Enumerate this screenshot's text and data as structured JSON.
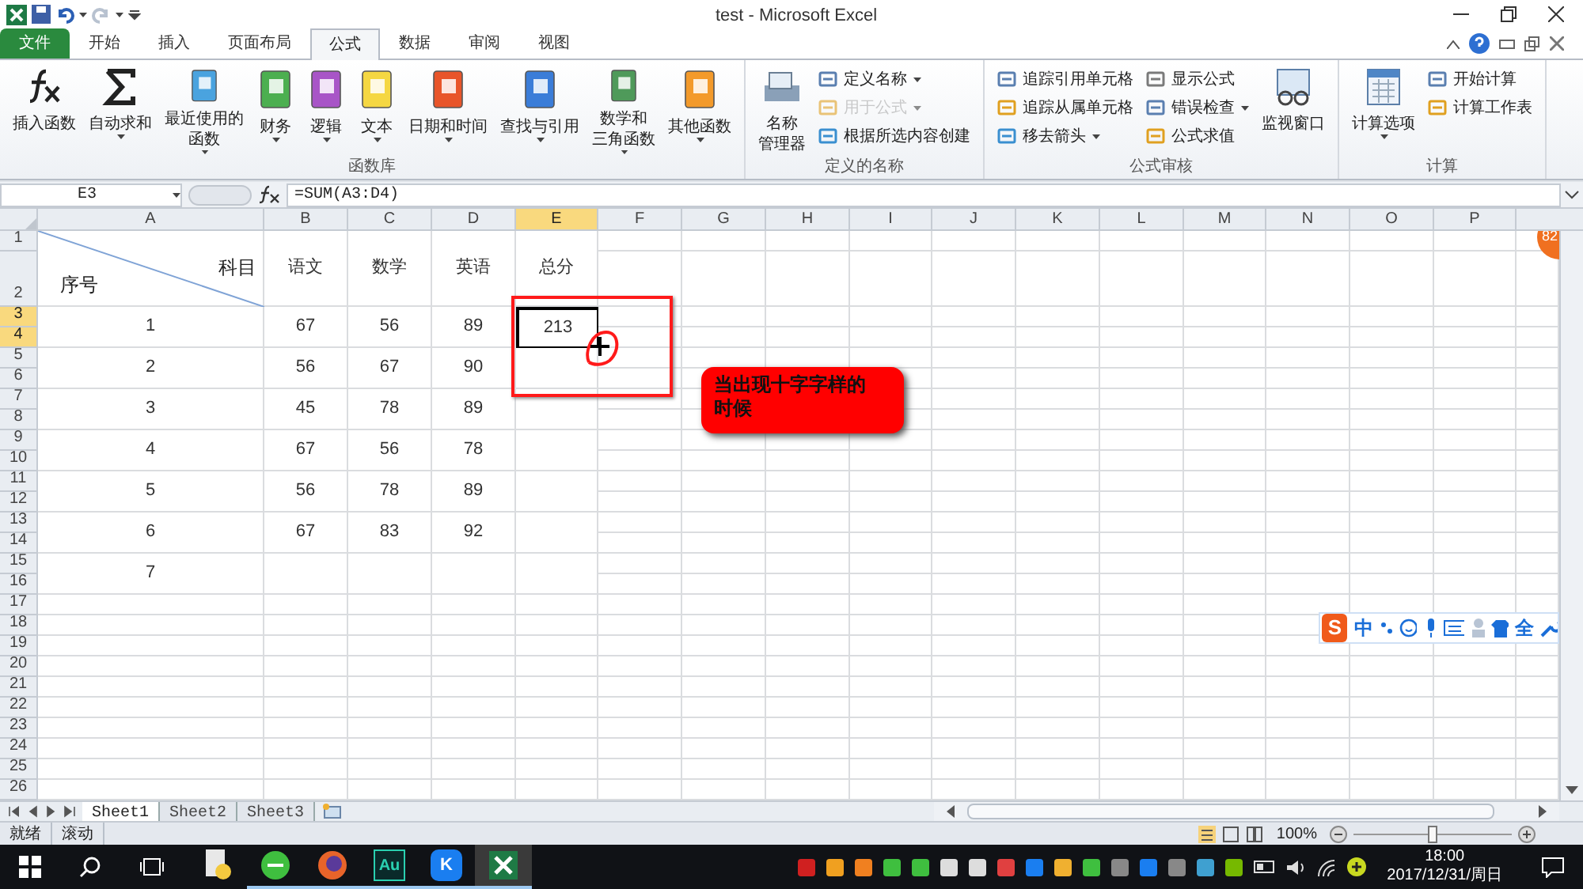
{
  "window": {
    "title": "test - Microsoft Excel"
  },
  "ribbon_tabs": [
    {
      "label": "文件",
      "kind": "file",
      "selected": false
    },
    {
      "label": "开始",
      "kind": "tab",
      "selected": false
    },
    {
      "label": "插入",
      "kind": "tab",
      "selected": false
    },
    {
      "label": "页面布局",
      "kind": "tab",
      "selected": false
    },
    {
      "label": "公式",
      "kind": "tab",
      "selected": true
    },
    {
      "label": "数据",
      "kind": "tab",
      "selected": false
    },
    {
      "label": "审阅",
      "kind": "tab",
      "selected": false
    },
    {
      "label": "视图",
      "kind": "tab",
      "selected": false
    }
  ],
  "ribbon_groups": [
    {
      "label": "函数库",
      "large": [
        {
          "lines": [
            "插入函数"
          ],
          "dropdown": false
        },
        {
          "lines": [
            "自动求和"
          ],
          "dropdown": true
        },
        {
          "lines": [
            "最近使用的",
            "函数"
          ],
          "dropdown": true
        },
        {
          "lines": [
            "财务"
          ],
          "dropdown": true
        },
        {
          "lines": [
            "逻辑"
          ],
          "dropdown": true
        },
        {
          "lines": [
            "文本"
          ],
          "dropdown": true
        },
        {
          "lines": [
            "日期和时间"
          ],
          "dropdown": true
        },
        {
          "lines": [
            "查找与引用"
          ],
          "dropdown": true
        },
        {
          "lines": [
            "数学和",
            "三角函数"
          ],
          "dropdown": true
        },
        {
          "lines": [
            "其他函数"
          ],
          "dropdown": true
        }
      ]
    },
    {
      "label": "定义的名称",
      "large": [
        {
          "lines": [
            "名称",
            "管理器"
          ],
          "dropdown": false
        }
      ],
      "small": [
        [
          {
            "label": "定义名称",
            "dropdown": true,
            "disabled": false
          },
          {
            "label": "用于公式",
            "dropdown": true,
            "disabled": true
          },
          {
            "label": "根据所选内容创建",
            "dropdown": false,
            "disabled": false
          }
        ]
      ]
    },
    {
      "label": "公式审核",
      "small": [
        [
          {
            "label": "追踪引用单元格",
            "dropdown": false,
            "disabled": false
          },
          {
            "label": "追踪从属单元格",
            "dropdown": false,
            "disabled": false
          },
          {
            "label": "移去箭头",
            "dropdown": true,
            "disabled": false
          }
        ],
        [
          {
            "label": "显示公式",
            "dropdown": false,
            "disabled": false
          },
          {
            "label": "错误检查",
            "dropdown": true,
            "disabled": false
          },
          {
            "label": "公式求值",
            "dropdown": false,
            "disabled": false
          }
        ]
      ],
      "trailing": [
        {
          "lines": [
            "监视窗口"
          ],
          "dropdown": false
        }
      ]
    },
    {
      "label": "计算",
      "large": [
        {
          "lines": [
            "计算选项"
          ],
          "dropdown": true
        }
      ],
      "small": [
        [
          {
            "label": "开始计算",
            "dropdown": false,
            "disabled": false
          },
          {
            "label": "计算工作表",
            "dropdown": false,
            "disabled": false
          }
        ]
      ]
    }
  ],
  "formula_bar": {
    "name_box": "E3",
    "formula": "=SUM(A3:D4)"
  },
  "columns": [
    {
      "label": "A",
      "selected": false
    },
    {
      "label": "B",
      "selected": false
    },
    {
      "label": "C",
      "selected": false
    },
    {
      "label": "D",
      "selected": false
    },
    {
      "label": "E",
      "selected": true
    },
    {
      "label": "F",
      "selected": false
    },
    {
      "label": "G",
      "selected": false
    },
    {
      "label": "H",
      "selected": false
    },
    {
      "label": "I",
      "selected": false
    },
    {
      "label": "J",
      "selected": false
    },
    {
      "label": "K",
      "selected": false
    },
    {
      "label": "L",
      "selected": false
    },
    {
      "label": "M",
      "selected": false
    },
    {
      "label": "N",
      "selected": false
    },
    {
      "label": "O",
      "selected": false
    },
    {
      "label": "P",
      "selected": false
    }
  ],
  "row_headers": [
    {
      "label": "1",
      "selected": false
    },
    {
      "label": "2",
      "selected": false
    },
    {
      "label": "3",
      "selected": true
    },
    {
      "label": "4",
      "selected": true
    },
    {
      "label": "5",
      "selected": false
    },
    {
      "label": "6",
      "selected": false
    },
    {
      "label": "7",
      "selected": false
    },
    {
      "label": "8",
      "selected": false
    },
    {
      "label": "9",
      "selected": false
    },
    {
      "label": "10",
      "selected": false
    },
    {
      "label": "11",
      "selected": false
    },
    {
      "label": "12",
      "selected": false
    },
    {
      "label": "13",
      "selected": false
    },
    {
      "label": "14",
      "selected": false
    },
    {
      "label": "15",
      "selected": false
    },
    {
      "label": "16",
      "selected": false
    },
    {
      "label": "17",
      "selected": false
    },
    {
      "label": "18",
      "selected": false
    },
    {
      "label": "19",
      "selected": false
    },
    {
      "label": "20",
      "selected": false
    },
    {
      "label": "21",
      "selected": false
    },
    {
      "label": "22",
      "selected": false
    },
    {
      "label": "23",
      "selected": false
    },
    {
      "label": "24",
      "selected": false
    },
    {
      "label": "25",
      "selected": false
    },
    {
      "label": "26",
      "selected": false
    }
  ],
  "table": {
    "corner_top": "科目",
    "corner_bottom": "序号",
    "headers": [
      "语文",
      "数学",
      "英语",
      "总分"
    ],
    "rows": [
      {
        "cells": [
          {
            "text": "1",
            "selected": false
          },
          {
            "text": "67",
            "selected": false
          },
          {
            "text": "56",
            "selected": false
          },
          {
            "text": "89",
            "selected": false
          },
          {
            "text": "213",
            "selected": true
          }
        ]
      },
      {
        "cells": [
          {
            "text": "2",
            "selected": false
          },
          {
            "text": "56",
            "selected": false
          },
          {
            "text": "67",
            "selected": false
          },
          {
            "text": "90",
            "selected": false
          }
        ]
      },
      {
        "cells": [
          {
            "text": "3",
            "selected": false
          },
          {
            "text": "45",
            "selected": false
          },
          {
            "text": "78",
            "selected": false
          },
          {
            "text": "89",
            "selected": false
          }
        ]
      },
      {
        "cells": [
          {
            "text": "4",
            "selected": false
          },
          {
            "text": "67",
            "selected": false
          },
          {
            "text": "56",
            "selected": false
          },
          {
            "text": "78",
            "selected": false
          }
        ]
      },
      {
        "cells": [
          {
            "text": "5",
            "selected": false
          },
          {
            "text": "56",
            "selected": false
          },
          {
            "text": "78",
            "selected": false
          },
          {
            "text": "89",
            "selected": false
          }
        ]
      },
      {
        "cells": [
          {
            "text": "6",
            "selected": false
          },
          {
            "text": "67",
            "selected": false
          },
          {
            "text": "83",
            "selected": false
          },
          {
            "text": "92",
            "selected": false
          }
        ]
      },
      {
        "cells": [
          {
            "text": "7",
            "selected": false
          }
        ]
      }
    ]
  },
  "callout": {
    "text": "当出现十字字样的时候"
  },
  "badge": {
    "text": "82"
  },
  "ime_bar": {
    "logo": "S",
    "mode": "中",
    "width_mode": "全"
  },
  "sheet_tabs": [
    {
      "label": "Sheet1",
      "selected": true
    },
    {
      "label": "Sheet2",
      "selected": false
    },
    {
      "label": "Sheet3",
      "selected": false
    }
  ],
  "status_bar": {
    "items": [
      "就绪",
      "滚动"
    ],
    "zoom": {
      "label": "100%",
      "level": 0.5
    }
  },
  "taskbar": {
    "apps": [
      {
        "kind": "python",
        "running": false,
        "active": false
      },
      {
        "kind": "browser",
        "running": true,
        "active": false
      },
      {
        "kind": "firefox",
        "running": true,
        "active": false
      },
      {
        "kind": "audition",
        "glyph": "Au",
        "running": true,
        "active": false
      },
      {
        "kind": "k",
        "glyph": "K",
        "running": true,
        "active": false
      },
      {
        "kind": "excel",
        "running": true,
        "active": true
      }
    ],
    "time": "18:00",
    "date": "2017/12/31/周日"
  }
}
